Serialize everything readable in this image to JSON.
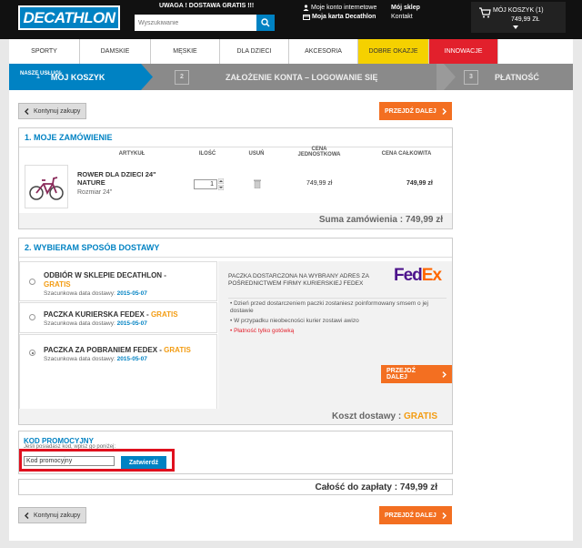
{
  "header": {
    "logo": "DECATHLON",
    "promo_banner": "UWAGA ! DOSTAWA GRATIS !!!",
    "search_placeholder": "Wyszukiwanie",
    "my_account": "Moje konto internetowe",
    "my_card": "Moja karta Decathlon",
    "my_store": "Mój sklep",
    "contact": "Kontakt",
    "cart_label": "MÓJ KOSZYK (1)",
    "cart_total": "749,99 ZŁ"
  },
  "nav": [
    {
      "label": "SPORTY",
      "bg": "#ffffff",
      "color": "#333333"
    },
    {
      "label": "DAMSKIE",
      "bg": "#ffffff",
      "color": "#333333"
    },
    {
      "label": "MĘSKIE",
      "bg": "#ffffff",
      "color": "#333333"
    },
    {
      "label": "DLA DZIECI",
      "bg": "#ffffff",
      "color": "#333333"
    },
    {
      "label": "AKCESORIA",
      "bg": "#ffffff",
      "color": "#333333"
    },
    {
      "label": "DOBRE OKAZJE",
      "bg": "#f5d100",
      "color": "#333333"
    },
    {
      "label": "INNOWACJE",
      "bg": "#e2202c",
      "color": "#ffffff"
    }
  ],
  "steps": {
    "overlay_label": "NASZE USŁUGI",
    "step1": {
      "num": "1",
      "label": "MÓJ KOSZYK"
    },
    "step2": {
      "num": "2",
      "label": "ZAŁOŻENIE KONTA – LOGOWANIE SIĘ"
    },
    "step3": {
      "num": "3",
      "label": "PŁATNOŚĆ"
    }
  },
  "buttons": {
    "continue": "Kontynuj zakupy",
    "next": "PRZEJDŹ DALEJ"
  },
  "order": {
    "title": "1. MOJE ZAMÓWIENIE",
    "columns": {
      "article": "ARTYKUŁ",
      "qty": "ILOŚĆ",
      "remove": "USUŃ",
      "unit_price": "CENA JEDNOSTKOWA",
      "total_price": "CENA CAŁKOWITA"
    },
    "item": {
      "name": "ROWER DLA DZIECI 24\" NATURE",
      "size": "Rozmiar 24\"",
      "qty": "1",
      "unit_price": "749,99 zł",
      "total": "749,99 zł"
    },
    "sum_label": "Suma zamówienia : 749,99 zł"
  },
  "delivery": {
    "title": "2. WYBIERAM SPOSÓB DOSTAWY",
    "options": [
      {
        "title": "ODBIÓR W SKLEPIE DECATHLON - ",
        "gratis": "GRATIS",
        "est_label": "Szacunkowa data dostawy: ",
        "date": "2015-05-07",
        "selected": false
      },
      {
        "title": "PACZKA KURIERSKA FEDEX - ",
        "gratis": "GRATIS",
        "est_label": "Szacunkowa data dostawy: ",
        "date": "2015-05-07",
        "selected": false
      },
      {
        "title": "PACZKA ZA POBRANIEM FEDEX - ",
        "gratis": "GRATIS",
        "est_label": "Szacunkowa data dostawy: ",
        "date": "2015-05-07",
        "selected": true
      }
    ],
    "info_title": "PACZKA DOSTARCZONA NA WYBRANY ADRES ZA POŚREDNICTWEM FIRMY KURIERSKIEJ FEDEX",
    "fedex_logo": "FedEx",
    "bullets": [
      "Dzień przed dostarczeniem paczki zostaniesz poinformowany smsem o jej dostawie",
      "W przypadku nieobecności kurier zostawi awizo"
    ],
    "payment_note": "Płatność tylko gotówką",
    "cost_label": "Koszt dostawy : ",
    "cost_value": "GRATIS"
  },
  "promo": {
    "title": "KOD PROMOCYJNY",
    "hint": "Jeśli posiadasz kod, wpisz go poniżej:",
    "input_value": "Kod promocyjny",
    "submit": "Zatwierdź"
  },
  "total": {
    "label": "Całość do zapłaty : 749,99 zł"
  }
}
